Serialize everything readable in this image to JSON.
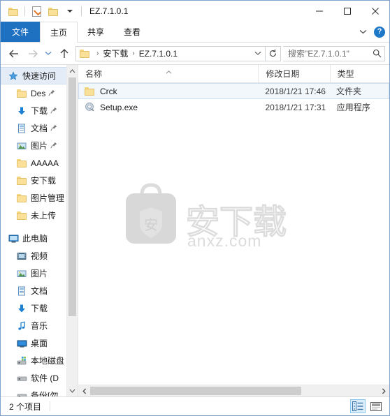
{
  "window": {
    "title": "EZ.7.1.0.1",
    "quick_access_toolbar": [
      {
        "icon": "folder-icon",
        "name": "qat-properties-folder"
      },
      {
        "icon": "properties-icon",
        "name": "qat-properties"
      },
      {
        "icon": "folder-icon",
        "name": "qat-new-folder"
      },
      {
        "icon": "chevron-down-icon",
        "name": "qat-customize"
      }
    ],
    "controls": {
      "minimize": "minimize",
      "maximize": "maximize",
      "close": "close"
    }
  },
  "ribbon": {
    "tabs": [
      {
        "label": "文件",
        "selected": true
      },
      {
        "label": "主页",
        "selected": false
      },
      {
        "label": "共享",
        "selected": false
      },
      {
        "label": "查看",
        "selected": false
      }
    ],
    "minimize_icon": "chevron-down-icon",
    "help_icon": "help-icon",
    "help_label": "?"
  },
  "address_bar": {
    "back_label": "←",
    "forward_label": "→",
    "recent_label": "⌄",
    "up_label": "↑",
    "breadcrumbs": [
      {
        "label": "安下载"
      },
      {
        "label": "EZ.7.1.0.1"
      }
    ],
    "separator": "›",
    "dropdown_icon": "chevron-down-icon",
    "refresh_icon": "refresh-icon",
    "refresh_label": "↻"
  },
  "search": {
    "placeholder": "搜索\"EZ.7.1.0.1\"",
    "icon": "search-icon"
  },
  "sidebar": {
    "items": [
      {
        "label": "快速访问",
        "icon": "star-icon",
        "indent": false,
        "selected": true,
        "pinned": false
      },
      {
        "label": "Des",
        "icon": "folder-icon",
        "indent": true,
        "selected": false,
        "pinned": true
      },
      {
        "label": "下载",
        "icon": "download-icon",
        "indent": true,
        "selected": false,
        "pinned": true
      },
      {
        "label": "文档",
        "icon": "document-icon",
        "indent": true,
        "selected": false,
        "pinned": true
      },
      {
        "label": "图片",
        "icon": "picture-icon",
        "indent": true,
        "selected": false,
        "pinned": true
      },
      {
        "label": "AAAAA",
        "icon": "folder-icon",
        "indent": true,
        "selected": false,
        "pinned": false
      },
      {
        "label": "安下载",
        "icon": "folder-icon",
        "indent": true,
        "selected": false,
        "pinned": false
      },
      {
        "label": "图片管理",
        "icon": "folder-icon",
        "indent": true,
        "selected": false,
        "pinned": false
      },
      {
        "label": "未上传",
        "icon": "folder-icon",
        "indent": true,
        "selected": false,
        "pinned": false
      },
      {
        "label": "此电脑",
        "icon": "this-pc-icon",
        "indent": false,
        "selected": false,
        "pinned": false,
        "group_start": true
      },
      {
        "label": "视频",
        "icon": "video-icon",
        "indent": true,
        "selected": false,
        "pinned": false
      },
      {
        "label": "图片",
        "icon": "picture-icon",
        "indent": true,
        "selected": false,
        "pinned": false
      },
      {
        "label": "文档",
        "icon": "document-icon",
        "indent": true,
        "selected": false,
        "pinned": false
      },
      {
        "label": "下载",
        "icon": "download-icon",
        "indent": true,
        "selected": false,
        "pinned": false
      },
      {
        "label": "音乐",
        "icon": "music-icon",
        "indent": true,
        "selected": false,
        "pinned": false
      },
      {
        "label": "桌面",
        "icon": "desktop-icon",
        "indent": true,
        "selected": false,
        "pinned": false
      },
      {
        "label": "本地磁盘",
        "icon": "local-disk-icon",
        "indent": true,
        "selected": false,
        "pinned": false
      },
      {
        "label": "软件 (D",
        "icon": "drive-icon",
        "indent": true,
        "selected": false,
        "pinned": false
      },
      {
        "label": "备份[勿",
        "icon": "drive-icon",
        "indent": true,
        "selected": false,
        "pinned": false
      }
    ],
    "scrollbar": {
      "up_icon": "chevron-up-icon",
      "down_icon": "chevron-down-icon"
    }
  },
  "file_list": {
    "columns": [
      {
        "label": "名称",
        "sorted": true,
        "sort_dir": "asc"
      },
      {
        "label": "修改日期",
        "sorted": false
      },
      {
        "label": "类型",
        "sorted": false
      }
    ],
    "rows": [
      {
        "name": "Crck",
        "date": "2018/1/21 17:46",
        "type": "文件夹",
        "icon": "folder-icon",
        "selected": true
      },
      {
        "name": "Setup.exe",
        "date": "2018/1/21 17:31",
        "type": "应用程序",
        "icon": "exe-icon",
        "selected": false
      }
    ],
    "scrollbar": {
      "left_icon": "chevron-left-icon",
      "right_icon": "chevron-right-icon"
    }
  },
  "watermark": {
    "text": "安下载",
    "subtext": "anxz.com",
    "shield_glyph": "安",
    "color": "#dcdcdc"
  },
  "status_bar": {
    "item_count_text": "2 个项目",
    "view_buttons": [
      {
        "name": "details-view-button",
        "icon": "details-view-icon",
        "active": true
      },
      {
        "name": "large-icons-view-button",
        "icon": "large-icons-view-icon",
        "active": false
      }
    ]
  }
}
